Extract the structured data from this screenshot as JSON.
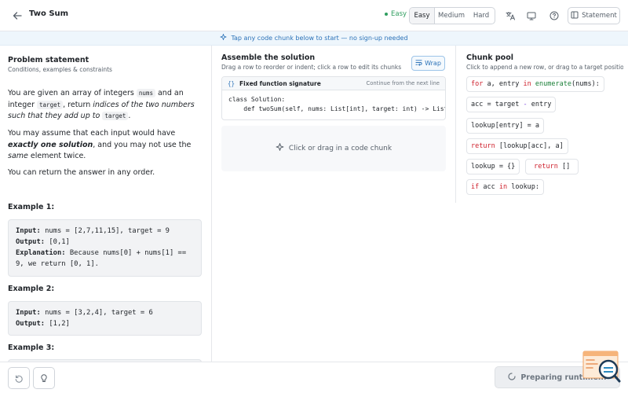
{
  "header": {
    "title": "Two Sum",
    "difficulty_status": "Easy",
    "difficulty_options": [
      "Easy",
      "Medium",
      "Hard"
    ],
    "selected_difficulty": "Easy",
    "statement_label": "Statement",
    "icons": [
      "back-arrow-icon",
      "translate-icon",
      "monitor-icon",
      "help-icon",
      "sidebar-icon"
    ],
    "status_color": "#2f9e5f"
  },
  "banner": {
    "text": "Tap any code chunk below to start — no sign-up needed",
    "color": "#2b72b8"
  },
  "problem": {
    "title": "Problem statement",
    "subtitle": "Conditions, examples & constraints",
    "p1_a": "You are given an array of integers ",
    "p1_code1": "nums",
    "p1_b": " and an integer ",
    "p1_code2": "target",
    "p1_c": ", return ",
    "p1_em": "indices of the two numbers such that they add up to",
    "p1_code3": "target",
    "p1_d": ".",
    "p2_a": "You may assume that each input would have ",
    "p2_strong": "exactly one solution",
    "p2_b": ", and you may not use the ",
    "p2_em": "same",
    "p2_c": " element twice.",
    "p3": "You can return the answer in any order.",
    "examples": [
      {
        "title": "Example 1:",
        "input_label": "Input:",
        "input": " nums = [2,7,11,15], target = 9",
        "output_label": "Output:",
        "output": " [0,1]",
        "explanation_label": "Explanation:",
        "explanation": " Because nums[0] + nums[1] == 9, we return [0, 1]."
      },
      {
        "title": "Example 2:",
        "input_label": "Input:",
        "input": " nums = [3,2,4], target = 6",
        "output_label": "Output:",
        "output": " [1,2]"
      },
      {
        "title": "Example 3:"
      }
    ]
  },
  "assemble": {
    "title": "Assemble the solution",
    "subtitle": "Drag a row to reorder or indent; click a row to edit its chunks",
    "wrap_label": "Wrap",
    "signature_label": "Fixed function signature",
    "signature_hint": "Continue from the next line",
    "signature_code": "class Solution:\n    def twoSum(self, nums: List[int], target: int) -> List[int]:",
    "dropzone_text": "Click or drag in a code chunk"
  },
  "pool": {
    "title": "Chunk pool",
    "subtitle": "Click to append a new row, or drag to a target position"
  },
  "footer": {
    "runtime_label": "Preparing runtime..."
  }
}
